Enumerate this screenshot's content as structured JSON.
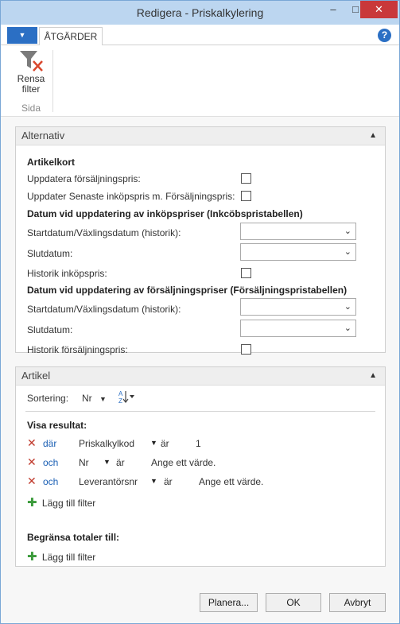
{
  "window": {
    "title": "Redigera - Priskalkylering",
    "minimize": "–",
    "maximize": "□",
    "close": "✕"
  },
  "ribbon": {
    "app_menu": "▼",
    "tab_active": "ÅTGÄRDER",
    "help": "?",
    "clear_filter_line1": "Rensa",
    "clear_filter_line2": "filter",
    "group_label": "Sida"
  },
  "alternativ": {
    "header": "Alternativ",
    "section_artikelkort": "Artikelkort",
    "update_sales_price": "Uppdatera försäljningspris:",
    "update_last_purchase": "Uppdater Senaste inköpspris m. Försäljningspris:",
    "section_purchase": "Datum vid uppdatering av  inköpspriser (Inkcöbspristabellen)",
    "purchase_start": "Startdatum/Växlingsdatum (historik):",
    "purchase_end": "Slutdatum:",
    "purchase_history": "Historik inköpspris:",
    "section_sales": "Datum vid uppdatering av försäljningspriser (Försäljningspristabellen)",
    "sales_start": "Startdatum/Växlingsdatum (historik):",
    "sales_end": "Slutdatum:",
    "sales_history": "Historik försäljningspris:"
  },
  "artikel": {
    "header": "Artikel",
    "sort_label": "Sortering:",
    "sort_value": "Nr",
    "show_results": "Visa resultat:",
    "filters": [
      {
        "connector": "där",
        "field": "Priskalkylkod",
        "op": "är",
        "value": "1"
      },
      {
        "connector": "och",
        "field": "Nr",
        "op": "är",
        "value": "Ange ett värde."
      },
      {
        "connector": "och",
        "field": "Leverantörsnr",
        "op": "är",
        "value": "Ange ett värde."
      }
    ],
    "add_filter": "Lägg till filter",
    "limit_totals": "Begränsa totaler till:",
    "add_filter_totals": "Lägg till filter"
  },
  "buttons": {
    "plan": "Planera...",
    "ok": "OK",
    "cancel": "Avbryt"
  },
  "icons": {
    "remove": "✕",
    "add": "✚",
    "chevron": "⌄",
    "collapse": "▲",
    "sort_caret": "▼"
  }
}
